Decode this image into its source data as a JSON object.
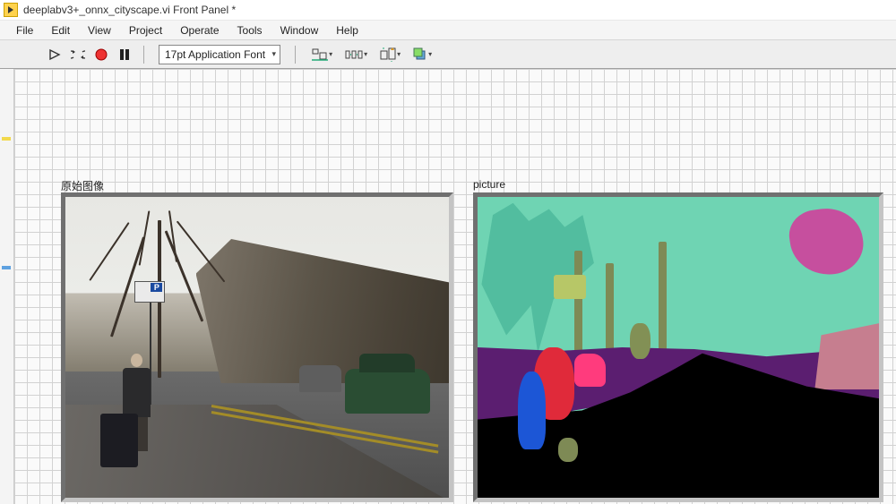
{
  "window": {
    "title": "deeplabv3+_onnx_cityscape.vi Front Panel *"
  },
  "menu": {
    "items": [
      "File",
      "Edit",
      "View",
      "Project",
      "Operate",
      "Tools",
      "Window",
      "Help"
    ]
  },
  "toolbar": {
    "run_tip": "Run",
    "run_continuous_tip": "Run Continuously",
    "abort_tip": "Abort",
    "pause_tip": "Pause",
    "font_label": "17pt Application Font",
    "align_tip": "Align Objects",
    "distribute_tip": "Distribute Objects",
    "resize_tip": "Resize Objects",
    "reorder_tip": "Reorder"
  },
  "panel": {
    "image1_label": "原始图像",
    "image2_label": "picture"
  }
}
